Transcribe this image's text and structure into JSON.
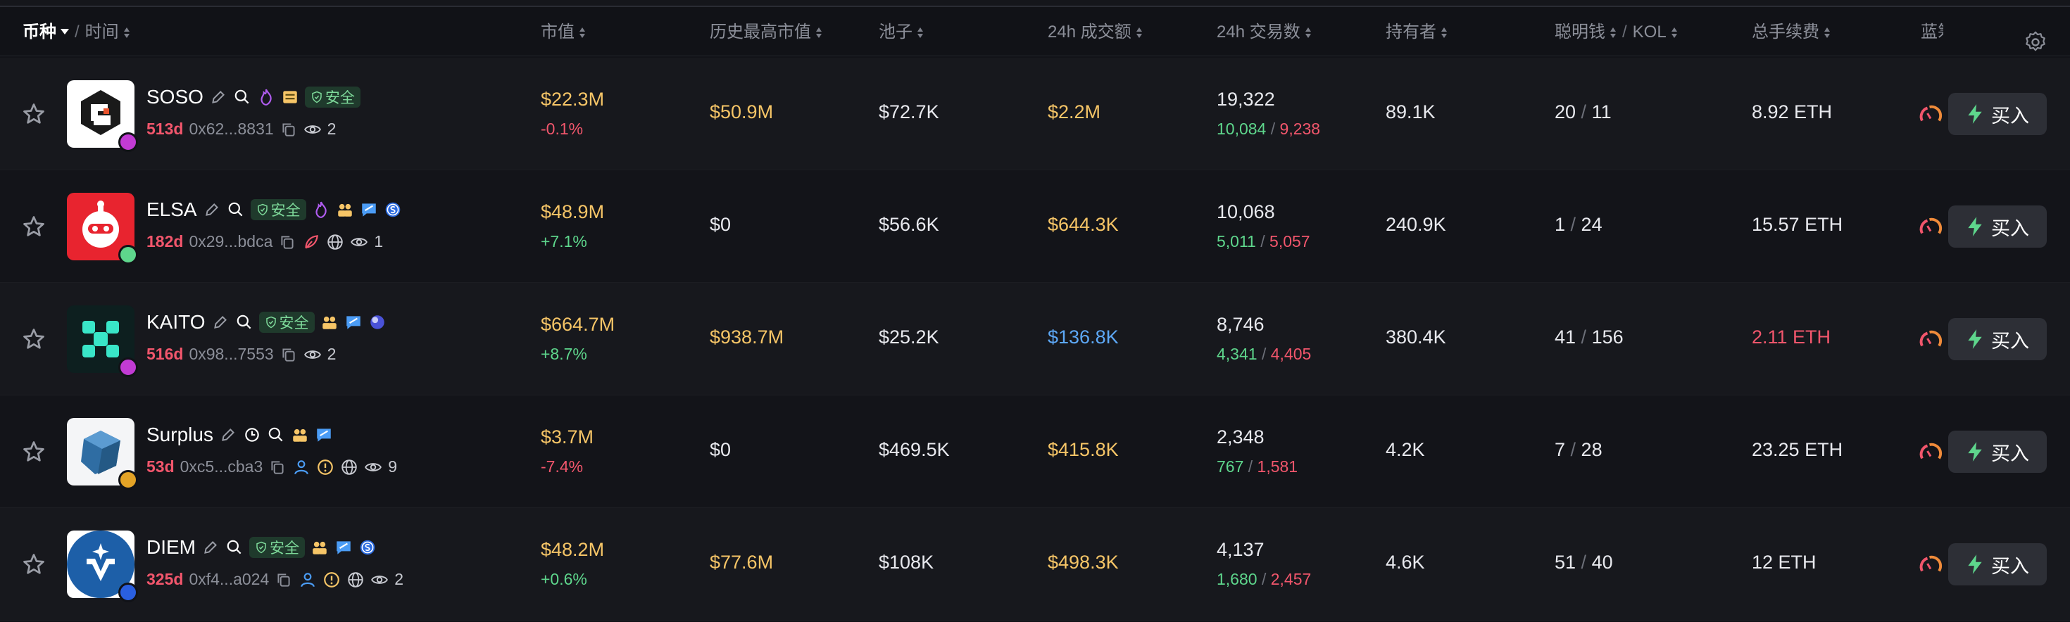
{
  "header": {
    "coin": "币种",
    "time_sep": "/",
    "time": "时间",
    "market_cap": "市值",
    "ath_market_cap": "历史最高市值",
    "pool": "池子",
    "volume_24h": "24h 成交额",
    "txns_24h": "24h 交易数",
    "holders": "持有者",
    "smart_money": "聪明钱",
    "smart_sep": "/",
    "kol": "KOL",
    "total_fees": "总手续费",
    "bluechip": "蓝筹",
    "settings_icon": "gear-icon"
  },
  "colors": {
    "background": "#111217",
    "row_odd": "#17181d",
    "row_even": "#131419",
    "positive": "#5ed68c",
    "negative": "#f2566c",
    "highlight": "#f6c567",
    "blue": "#5da8f7"
  },
  "buy_label": "买入",
  "safe_label": "安全",
  "tokens": [
    {
      "name": "SOSO",
      "age": "513d",
      "address": "0x62...8831",
      "watchers": "2",
      "market_cap": "$22.3M",
      "change": "-0.1%",
      "ath": "$50.9M",
      "pool": "$72.7K",
      "volume": "$2.2M",
      "txns": "19,322",
      "buys": "10,084",
      "sells": "9,238",
      "holders": "89.1K",
      "smart": "20",
      "kol": "11",
      "fees": "8.92 ETH"
    },
    {
      "name": "ELSA",
      "age": "182d",
      "address": "0x29...bdca",
      "watchers": "1",
      "market_cap": "$48.9M",
      "change": "+7.1%",
      "ath": "$0",
      "pool": "$56.6K",
      "volume": "$644.3K",
      "txns": "10,068",
      "buys": "5,011",
      "sells": "5,057",
      "holders": "240.9K",
      "smart": "1",
      "kol": "24",
      "fees": "15.57 ETH"
    },
    {
      "name": "KAITO",
      "age": "516d",
      "address": "0x98...7553",
      "watchers": "2",
      "market_cap": "$664.7M",
      "change": "+8.7%",
      "ath": "$938.7M",
      "pool": "$25.2K",
      "volume": "$136.8K",
      "txns": "8,746",
      "buys": "4,341",
      "sells": "4,405",
      "holders": "380.4K",
      "smart": "41",
      "kol": "156",
      "fees": "2.11 ETH"
    },
    {
      "name": "Surplus",
      "age": "53d",
      "address": "0xc5...cba3",
      "watchers": "9",
      "market_cap": "$3.7M",
      "change": "-7.4%",
      "ath": "$0",
      "pool": "$469.5K",
      "volume": "$415.8K",
      "txns": "2,348",
      "buys": "767",
      "sells": "1,581",
      "holders": "4.2K",
      "smart": "7",
      "kol": "28",
      "fees": "23.25 ETH"
    },
    {
      "name": "DIEM",
      "age": "325d",
      "address": "0xf4...a024",
      "watchers": "2",
      "market_cap": "$48.2M",
      "change": "+0.6%",
      "ath": "$77.6M",
      "pool": "$108K",
      "volume": "$498.3K",
      "txns": "4,137",
      "buys": "1,680",
      "sells": "2,457",
      "holders": "4.6K",
      "smart": "51",
      "kol": "40",
      "fees": "12 ETH"
    }
  ]
}
